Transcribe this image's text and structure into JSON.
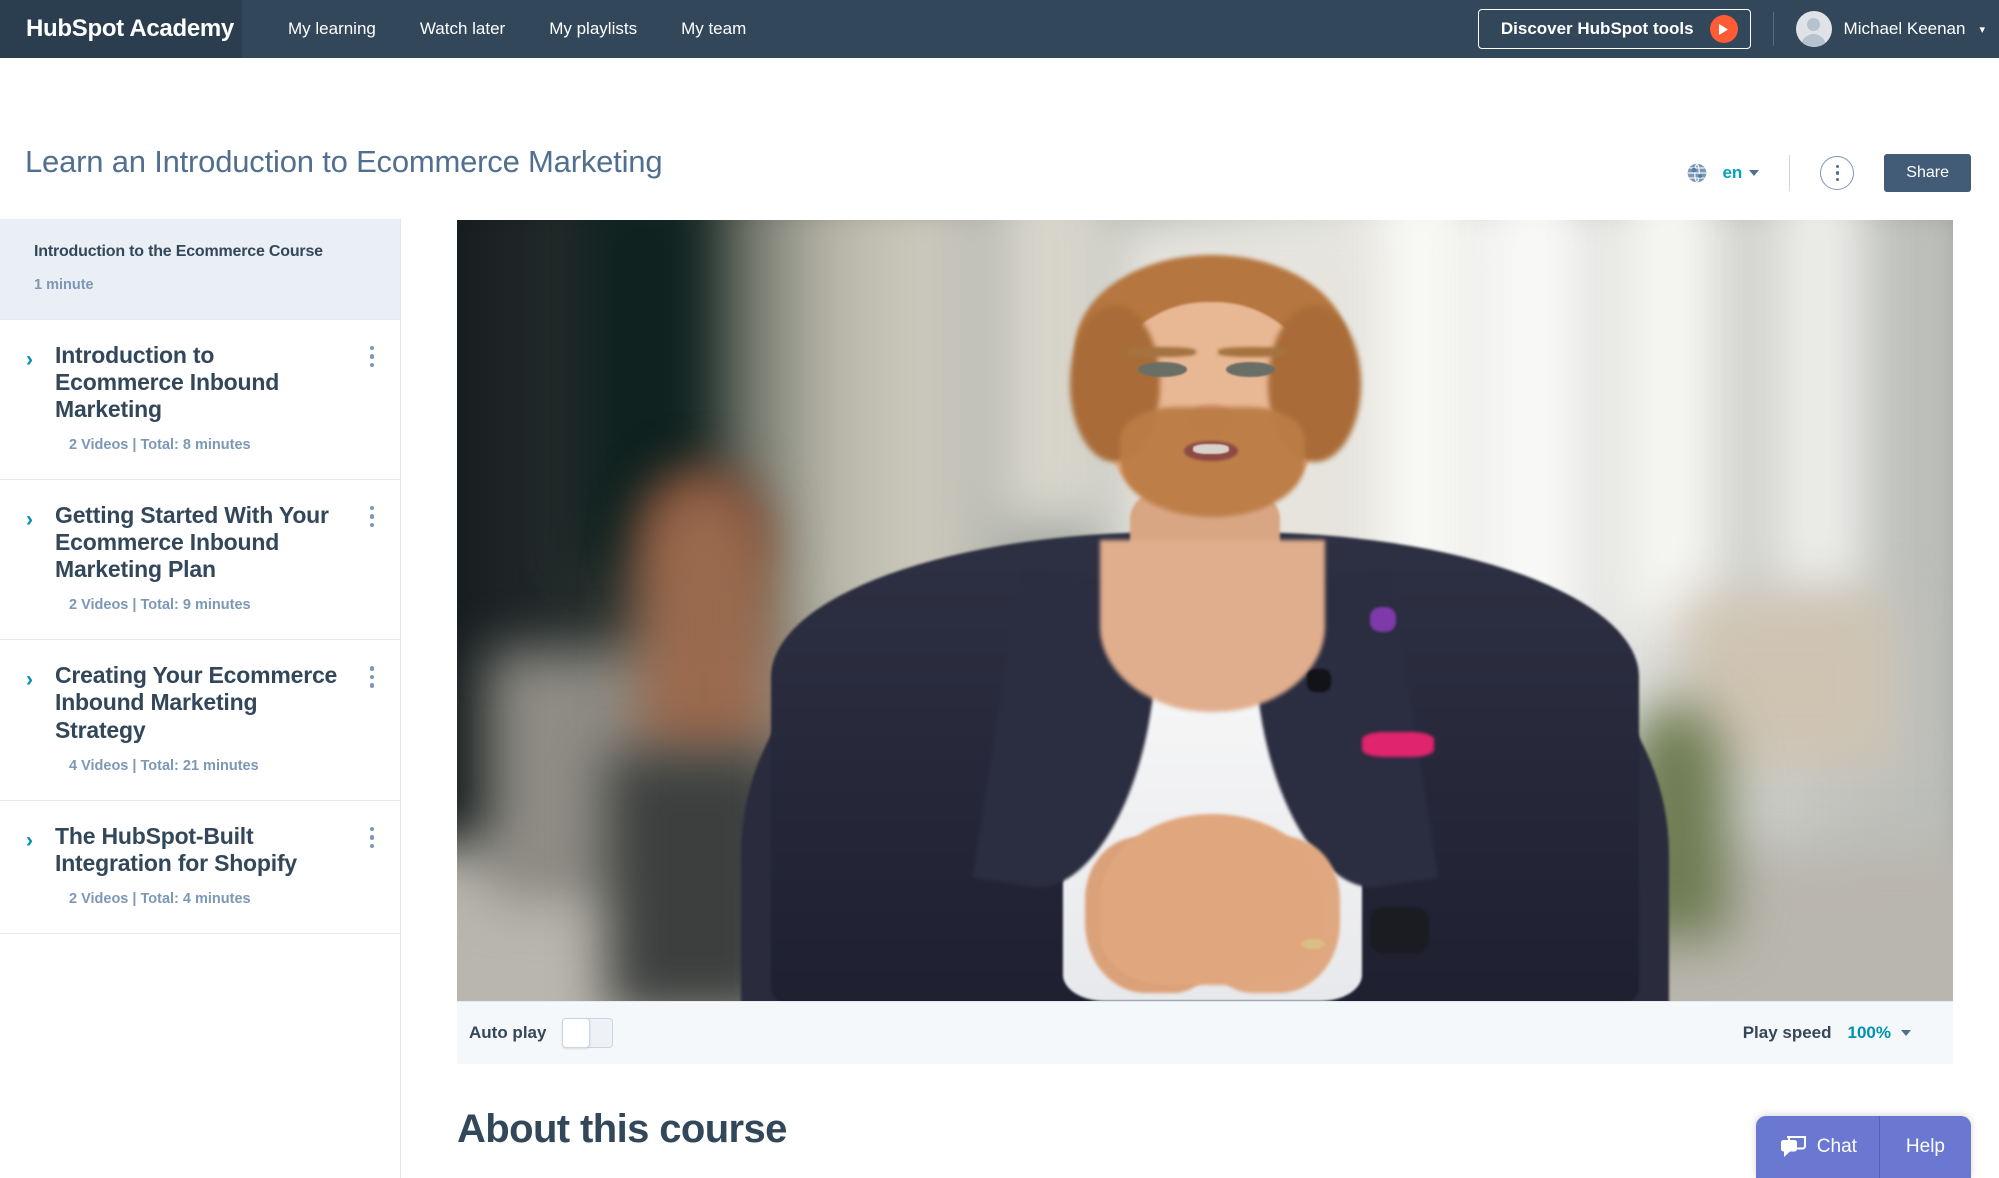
{
  "topnav": {
    "logo": "HubSpot Academy",
    "links": [
      {
        "label": "My learning"
      },
      {
        "label": "Watch later"
      },
      {
        "label": "My playlists"
      },
      {
        "label": "My team"
      }
    ],
    "discover_button": "Discover HubSpot tools",
    "discover_icon": "play-circle-icon",
    "user_name": "Michael Keenan",
    "avatar_icon": "user-avatar-icon",
    "caret_icon": "chevron-down-icon",
    "bg_color": "#33475b",
    "accent_orange": "#ff5c35"
  },
  "header": {
    "title": "Learn an Introduction to Ecommerce Marketing",
    "globe_icon": "globe-icon",
    "language": "en",
    "language_caret": "caret-down-icon",
    "more_icon": "kebab-menu-icon",
    "share_label": "Share",
    "title_color": "#516f90",
    "teal": "#00a4bd"
  },
  "sidebar": {
    "items": [
      {
        "title": "Introduction to the Ecommerce Course",
        "meta": "1 minute",
        "active": true,
        "chevron": "",
        "kebab": false
      },
      {
        "title": "Introduction to Ecommerce Inbound Marketing",
        "meta": "2 Videos | Total: 8 minutes",
        "active": false,
        "chevron": "›",
        "kebab": true
      },
      {
        "title": "Getting Started With Your Ecommerce Inbound Marketing Plan",
        "meta": "2 Videos | Total: 9 minutes",
        "active": false,
        "chevron": "›",
        "kebab": true
      },
      {
        "title": "Creating Your Ecommerce Inbound Marketing Strategy",
        "meta": "4 Videos | Total: 21 minutes",
        "active": false,
        "chevron": "›",
        "kebab": true
      },
      {
        "title": "The HubSpot-Built Integration for Shopify",
        "meta": "2 Videos | Total: 4 minutes",
        "active": false,
        "chevron": "›",
        "kebab": true
      }
    ],
    "active_bg": "#eaeff5",
    "chevron_color": "#0091ae"
  },
  "player": {
    "video_description": "Blurred modern office interior with a bearded man in a dark navy suit and open white shirt, hands clasped, speaking to camera",
    "autoplay_label": "Auto play",
    "autoplay_on": false,
    "speed_label": "Play speed",
    "speed_value": "100%",
    "speed_caret": "caret-down-icon"
  },
  "about": {
    "heading": "About this course"
  },
  "chat": {
    "chat_label": "Chat",
    "help_label": "Help",
    "chat_icon": "chat-bubble-icon",
    "bg_color": "#6a78d1"
  }
}
